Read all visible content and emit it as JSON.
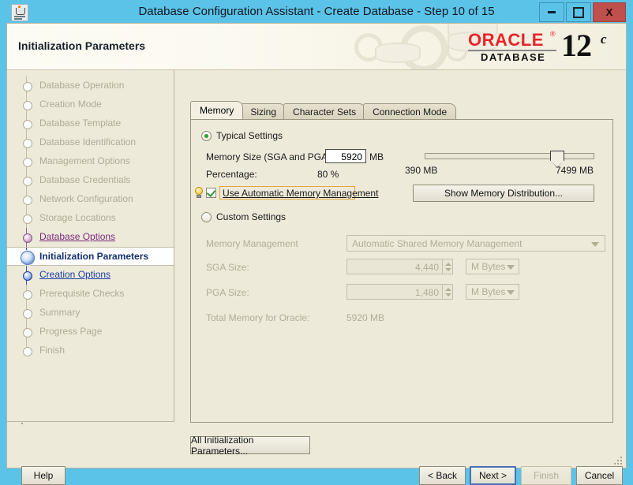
{
  "window": {
    "title": "Database Configuration Assistant - Create Database - Step 10 of 15",
    "app_icon": "java-coffee-cup-icon",
    "minimize_label": "",
    "maximize_label": "",
    "close_label": "X"
  },
  "header": {
    "title": "Initialization Parameters",
    "logo": {
      "brand": "ORACLE",
      "registered": "®",
      "product": "DATABASE",
      "version": "12",
      "version_suffix": "c"
    }
  },
  "sidebar": {
    "items": [
      {
        "label": "Database Operation",
        "state": "done"
      },
      {
        "label": "Creation Mode",
        "state": "done"
      },
      {
        "label": "Database Template",
        "state": "done"
      },
      {
        "label": "Database Identification",
        "state": "done"
      },
      {
        "label": "Management Options",
        "state": "done"
      },
      {
        "label": "Database Credentials",
        "state": "done"
      },
      {
        "label": "Network Configuration",
        "state": "done"
      },
      {
        "label": "Storage Locations",
        "state": "done"
      },
      {
        "label": "Database Options",
        "state": "visited"
      },
      {
        "label": "Initialization Parameters",
        "state": "current"
      },
      {
        "label": "Creation Options",
        "state": "link"
      },
      {
        "label": "Prerequisite Checks",
        "state": "done"
      },
      {
        "label": "Summary",
        "state": "done"
      },
      {
        "label": "Progress Page",
        "state": "done"
      },
      {
        "label": "Finish",
        "state": "done"
      }
    ]
  },
  "tabs": [
    {
      "label": "Memory",
      "active": true
    },
    {
      "label": "Sizing",
      "active": false
    },
    {
      "label": "Character Sets",
      "active": false
    },
    {
      "label": "Connection Mode",
      "active": false
    }
  ],
  "memory_tab": {
    "typical": {
      "radio_label": "Typical Settings",
      "selected": true,
      "memory_size_label": "Memory Size (SGA and PGA):",
      "memory_size_value": "5920",
      "memory_size_unit": "MB",
      "percentage_label": "Percentage:",
      "percentage_value": "80 %",
      "amm_checkbox_label": "Use Automatic Memory Management",
      "amm_checked": true,
      "hint_icon": "lightbulb-icon",
      "slider": {
        "min_label": "390 MB",
        "max_label": "7499 MB",
        "min": 390,
        "max": 7499,
        "value": 5920
      },
      "show_memory_distribution_button": "Show Memory Distribution..."
    },
    "custom": {
      "radio_label": "Custom Settings",
      "selected": false,
      "memory_management_label": "Memory Management",
      "memory_management_value": "Automatic Shared Memory Management",
      "sga_label": "SGA Size:",
      "sga_value": "4,440",
      "sga_unit": "M Bytes",
      "pga_label": "PGA Size:",
      "pga_value": "1,480",
      "pga_unit": "M Bytes",
      "total_label": "Total Memory for Oracle:",
      "total_value": "5920 MB"
    }
  },
  "footer": {
    "all_params_button": "All Initialization Parameters...",
    "help_button": "Help",
    "back_button": "< Back",
    "next_button": "Next >",
    "finish_button": "Finish",
    "cancel_button": "Cancel"
  },
  "colors": {
    "titlebar": "#5cc3e8",
    "background": "#edeada",
    "oracle_red": "#e8242a",
    "current_step_text": "#14306e",
    "visited_link": "#7b2b7b",
    "link": "#1b3fa0",
    "focus_outline": "#e8a33d",
    "close_button": "#c0504d"
  }
}
